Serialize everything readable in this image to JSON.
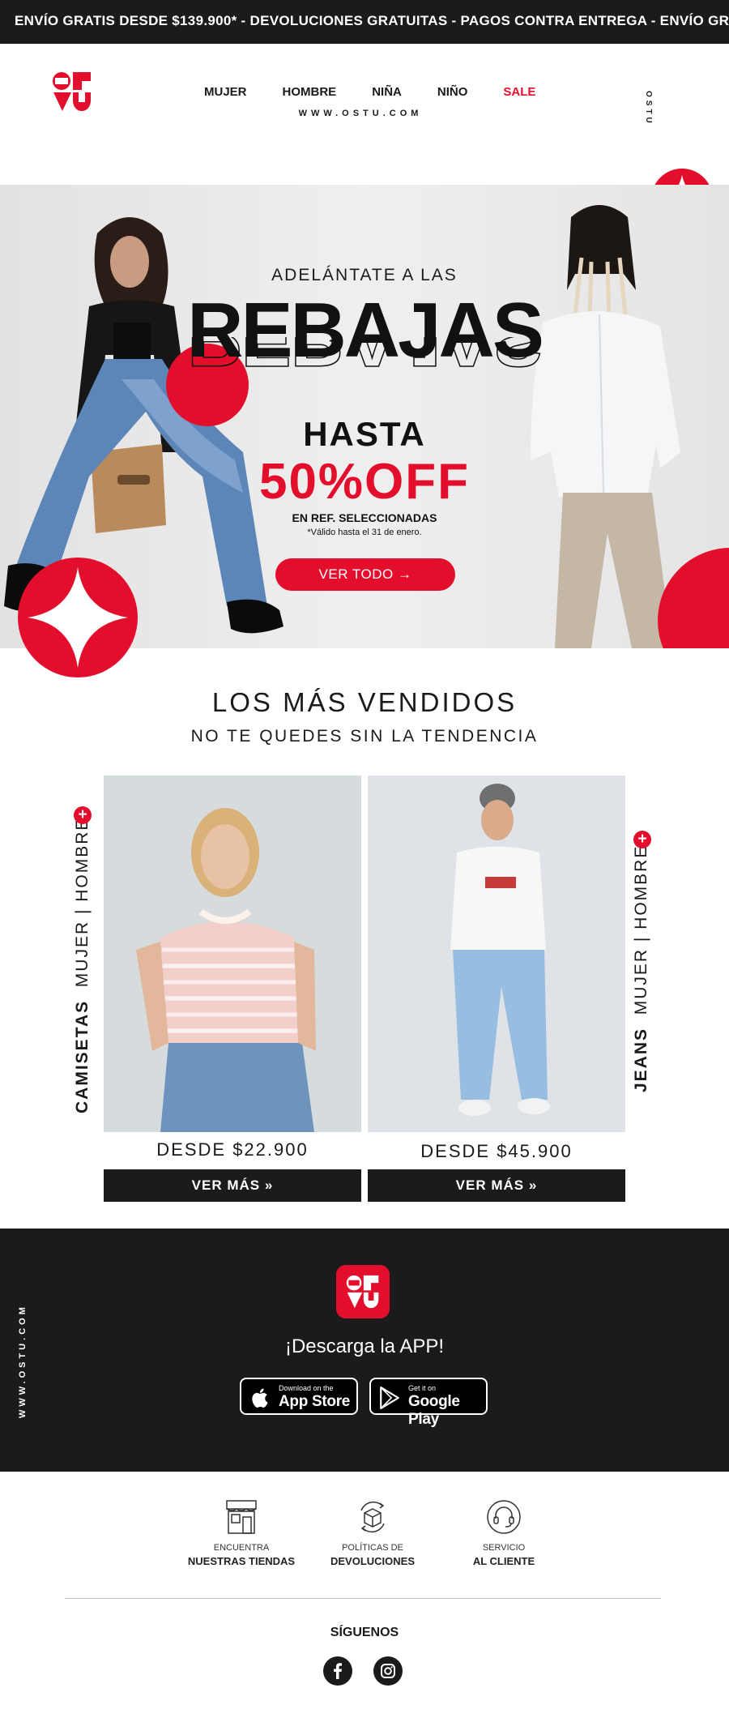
{
  "topbar": {
    "announcement": "ENVÍO GRATIS DESDE $139.900* - DEVOLUCIONES GRATUITAS - PAGOS CONTRA ENTREGA  - ENVÍO GRATIS DESDE $139.900*"
  },
  "header": {
    "nav": [
      {
        "label": "MUJER"
      },
      {
        "label": "HOMBRE"
      },
      {
        "label": "NIÑA"
      },
      {
        "label": "NIÑO"
      },
      {
        "label": "SALE"
      }
    ],
    "website": "WWW.OSTU.COM",
    "vertical_brand": "OSTU"
  },
  "hero": {
    "pre_title": "ADELÁNTATE A LAS",
    "title": "REBAJAS",
    "upto": "HASTA",
    "discount": "50%OFF",
    "note": "EN REF. SELECCIONADAS",
    "validity": "*Válido hasta el 31 de enero.",
    "cta": "VER TODO →"
  },
  "bestsellers": {
    "title": "LOS MÁS VENDIDOS",
    "subtitle": "NO TE QUEDES SIN LA TENDENCIA",
    "products": [
      {
        "category": "CAMISETAS",
        "audience": "MUJER | HOMBRE",
        "price": "DESDE $22.900",
        "button": "VER MÁS »"
      },
      {
        "category": "JEANS",
        "audience": "MUJER | HOMBRE",
        "price": "DESDE $45.900",
        "button": "VER MÁS »"
      }
    ],
    "plus": "+"
  },
  "app": {
    "title": "¡Descarga la APP!",
    "appstore": {
      "small": "Download on the",
      "big": "App Store"
    },
    "googleplay": {
      "small": "Get it on",
      "big": "Google Play"
    },
    "vertical_url": "WWW.OSTU.COM"
  },
  "services": [
    {
      "line1": "ENCUENTRA",
      "line2": "NUESTRAS TIENDAS",
      "icon": "store-icon"
    },
    {
      "line1": "POLÍTICAS DE",
      "line2": "DEVOLUCIONES",
      "icon": "return-box-icon"
    },
    {
      "line1": "SERVICIO",
      "line2": "AL CLIENTE",
      "icon": "headset-icon"
    }
  ],
  "social": {
    "title": "SÍGUENOS"
  },
  "colors": {
    "brand_red": "#e30e2c",
    "dark": "#1b1b1b"
  }
}
